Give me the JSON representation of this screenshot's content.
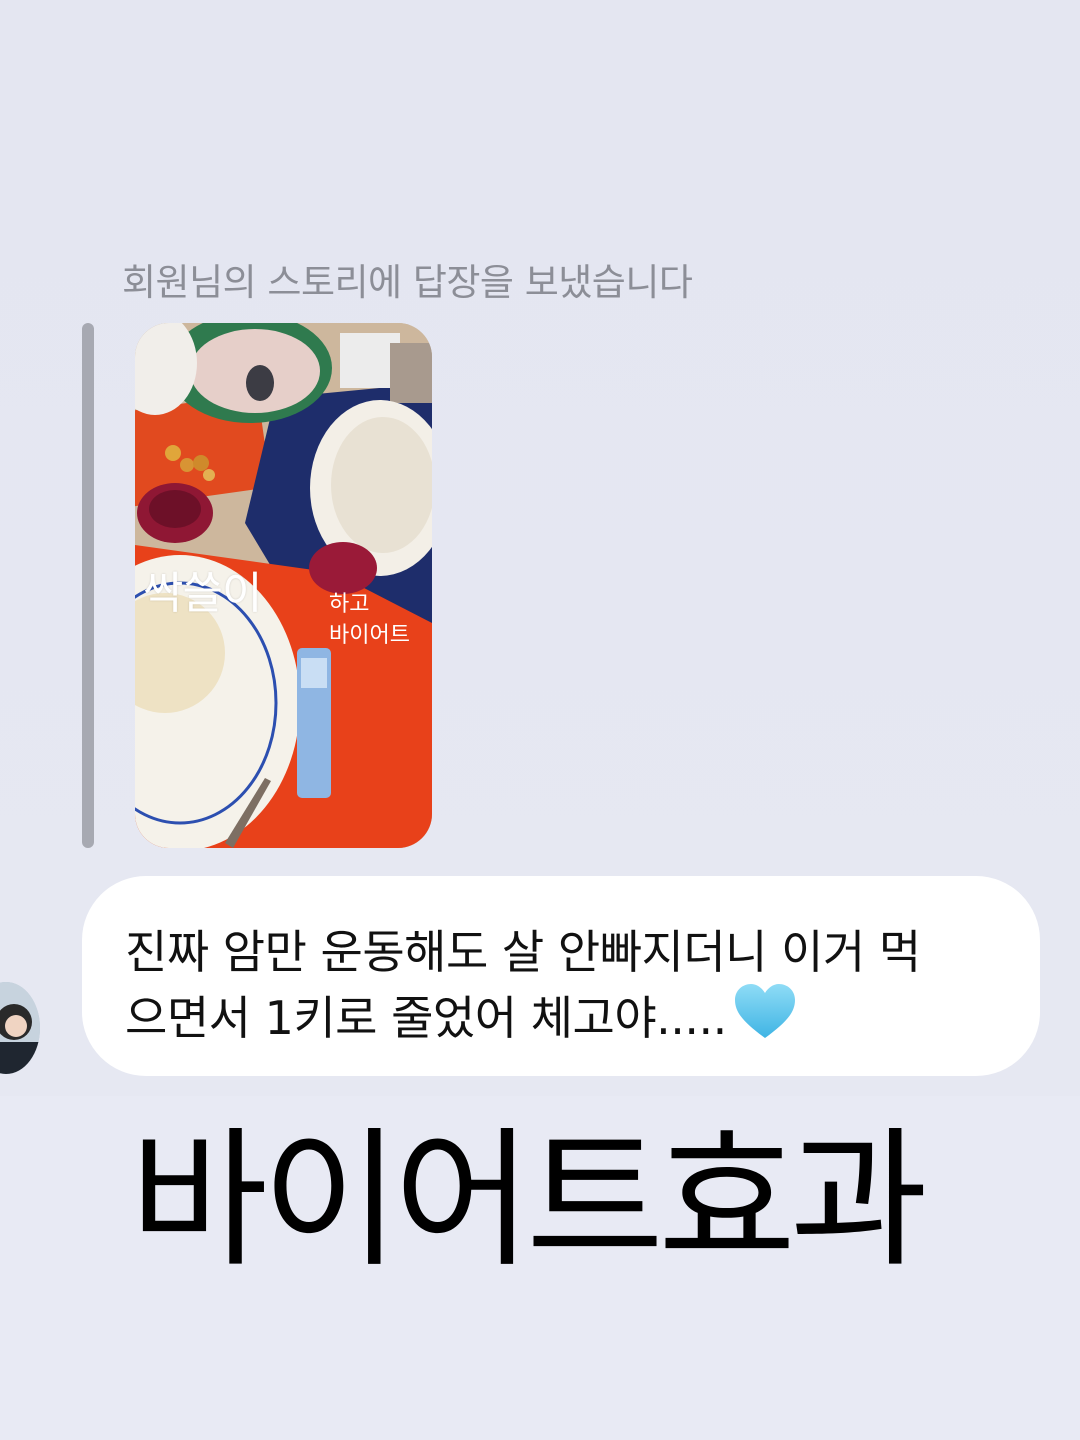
{
  "reply": {
    "caption": "회원님의 스토리에 답장을 보냈습니다"
  },
  "story": {
    "overlay_big": "싹쓸이",
    "overlay_small_1": "하고",
    "overlay_small_2": "바이어트"
  },
  "message": {
    "line1": "진짜 암만 운동해도 살 안빠지더니 이거 먹",
    "line2": "으면서 1키로 줄었어 체고야.....",
    "emoji": "light-blue-heart"
  },
  "headline": {
    "text": "바이어트효과"
  },
  "colors": {
    "background": "#e4e6f1",
    "bubble": "#ffffff",
    "caption_text": "#8c8e97",
    "heart": "#5ec8ee"
  }
}
